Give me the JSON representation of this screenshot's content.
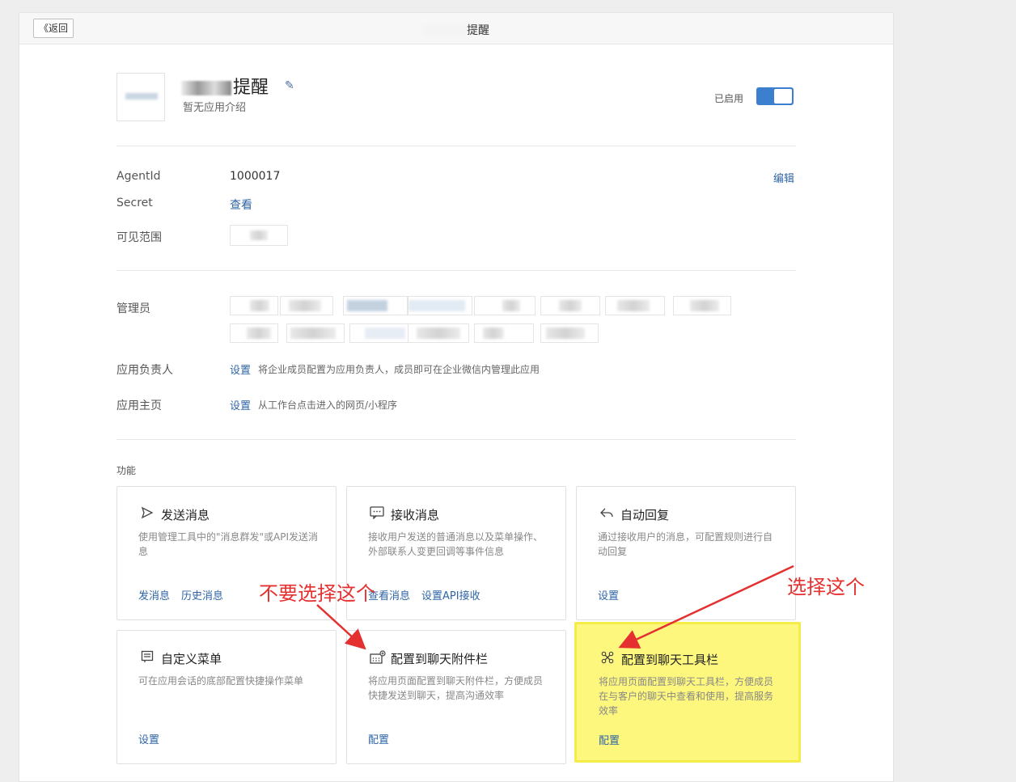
{
  "header": {
    "back_label": "《返回",
    "title": "提醒"
  },
  "app": {
    "name": "提醒",
    "description": "暂无应用介绍",
    "status_label": "已启用"
  },
  "details": {
    "agentid_label": "AgentId",
    "agentid_value": "1000017",
    "edit_label": "编辑",
    "secret_label": "Secret",
    "secret_view": "查看",
    "scope_label": "可见范围",
    "admin_label": "管理员",
    "owner_label": "应用负责人",
    "owner_link": "设置",
    "owner_hint": "将企业成员配置为应用负责人，成员即可在企业微信内管理此应用",
    "homepage_label": "应用主页",
    "homepage_link": "设置",
    "homepage_hint": "从工作台点击进入的网页/小程序"
  },
  "features": {
    "section_title": "功能",
    "cards": [
      {
        "icon": "send-icon",
        "title": "发送消息",
        "desc": "使用管理工具中的\"消息群发\"或API发送消息",
        "links": [
          "发消息",
          "历史消息"
        ]
      },
      {
        "icon": "chat-bubble-icon",
        "title": "接收消息",
        "desc": "接收用户发送的普通消息以及菜单操作、外部联系人变更回调等事件信息",
        "links": [
          "查看消息",
          "设置API接收"
        ]
      },
      {
        "icon": "reply-icon",
        "title": "自动回复",
        "desc": "通过接收用户的消息，可配置规则进行自动回复",
        "links": [
          "设置"
        ]
      },
      {
        "icon": "menu-icon",
        "title": "自定义菜单",
        "desc": "可在应用会话的底部配置快捷操作菜单",
        "links": [
          "设置"
        ]
      },
      {
        "icon": "attachment-bar-icon",
        "title": "配置到聊天附件栏",
        "desc": "将应用页面配置到聊天附件栏，方便成员快捷发送到聊天，提高沟通效率",
        "links": [
          "配置"
        ]
      },
      {
        "icon": "toolbar-icon",
        "title": "配置到聊天工具栏",
        "desc": "将应用页面配置到聊天工具栏，方便成员在与客户的聊天中查看和使用，提高服务效率",
        "links": [
          "配置"
        ]
      }
    ]
  },
  "annotations": {
    "dont_select": "不要选择这个",
    "select_this": "选择这个",
    "color": "#e53030",
    "highlight_color": "#fdf77e"
  }
}
